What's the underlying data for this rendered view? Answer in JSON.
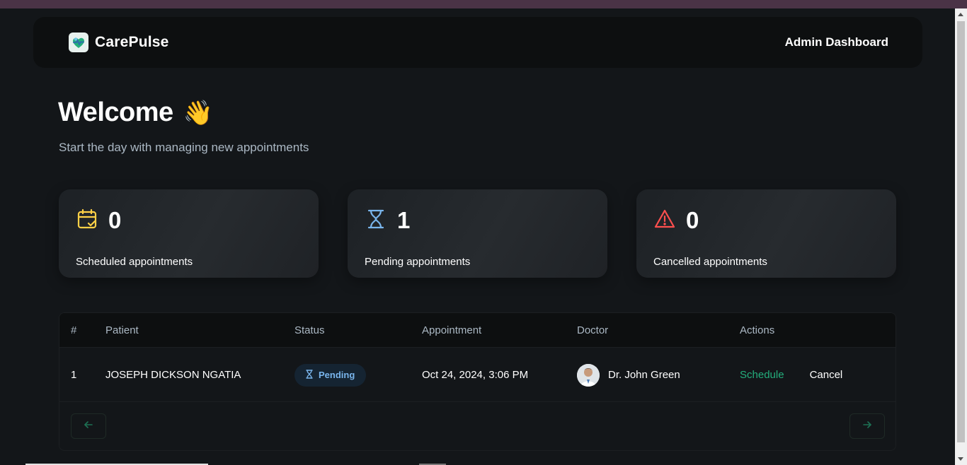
{
  "header": {
    "brand_name": "CarePulse",
    "admin_title": "Admin Dashboard"
  },
  "welcome": {
    "title": "Welcome",
    "emoji": "👋",
    "subtitle": "Start the day with managing new appointments"
  },
  "stats": [
    {
      "icon": "calendar-check-icon",
      "count": "0",
      "label": "Scheduled appointments",
      "color": "#ffd147"
    },
    {
      "icon": "hourglass-icon",
      "count": "1",
      "label": "Pending appointments",
      "color": "#79b5ec"
    },
    {
      "icon": "warning-icon",
      "count": "0",
      "label": "Cancelled appointments",
      "color": "#ff4f4e"
    }
  ],
  "table": {
    "headers": {
      "num": "#",
      "patient": "Patient",
      "status": "Status",
      "appointment": "Appointment",
      "doctor": "Doctor",
      "actions": "Actions"
    },
    "rows": [
      {
        "num": "1",
        "patient": "JOSEPH DICKSON NGATIA",
        "status": "Pending",
        "appointment": "Oct 24, 2024, 3:06 PM",
        "doctor": "Dr. John Green",
        "schedule_label": "Schedule",
        "cancel_label": "Cancel"
      }
    ]
  },
  "pagination": {
    "prev_icon": "arrow-left-icon",
    "next_icon": "arrow-right-icon"
  },
  "colors": {
    "background": "#131619",
    "accent_green": "#24ae7c",
    "pending_blue": "#79b5ec",
    "warning_red": "#ff4f4e",
    "scheduled_yellow": "#ffd147"
  }
}
